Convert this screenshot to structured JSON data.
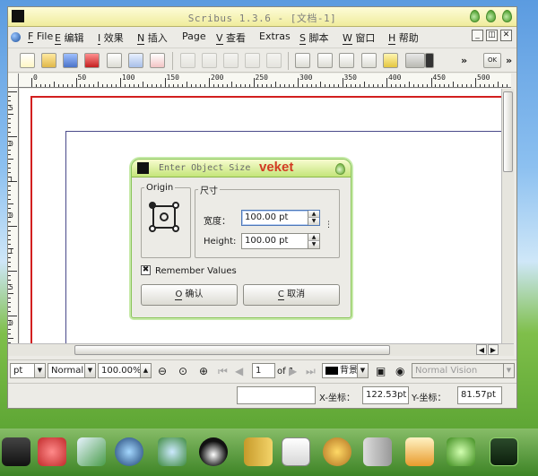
{
  "window": {
    "title": "Scribus 1.3.6 - [文档-1]"
  },
  "menu": [
    {
      "key": "F",
      "label": "File"
    },
    {
      "key": "E",
      "label": "编辑"
    },
    {
      "key": "I",
      "label": "效果"
    },
    {
      "key": "N",
      "label": "插入"
    },
    {
      "key": "",
      "label": "Page"
    },
    {
      "key": "V",
      "label": "查看"
    },
    {
      "key": "",
      "label": "Extras"
    },
    {
      "key": "S",
      "label": "脚本"
    },
    {
      "key": "W",
      "label": "窗口"
    },
    {
      "key": "H",
      "label": "帮助"
    }
  ],
  "toolbar": {
    "overflow_1": "»",
    "overflow_2": "»",
    "ok_label": "OK"
  },
  "ruler": {
    "h_labels": [
      "0",
      "50",
      "100",
      "150",
      "200",
      "250",
      "300",
      "350",
      "400",
      "450",
      "500"
    ],
    "v_labels": [
      "5",
      "0",
      "1",
      "0",
      "1",
      "5",
      "0"
    ]
  },
  "dialog": {
    "title": "Enter Object Size",
    "badge": "veket",
    "origin_label": "Origin",
    "size_label": "尺寸",
    "width_label": "宽度：",
    "width_value": "100.00 pt",
    "height_label": "Height:",
    "height_value": "100.00 pt",
    "remember_label": "Remember Values",
    "remember_checked": "✖",
    "ok_key": "O",
    "ok_label": "确认",
    "cancel_key": "C",
    "cancel_label": "取消"
  },
  "bottom": {
    "unit": "pt",
    "mode": "Normal",
    "zoom": "100.00%",
    "page": "1",
    "page_of": "of 1",
    "layer": "背景",
    "vision": "Normal Vision"
  },
  "status": {
    "x_label": "X-坐标：",
    "x_value": "122.53pt",
    "y_label": "Y-坐标：",
    "y_value": "81.57pt"
  }
}
